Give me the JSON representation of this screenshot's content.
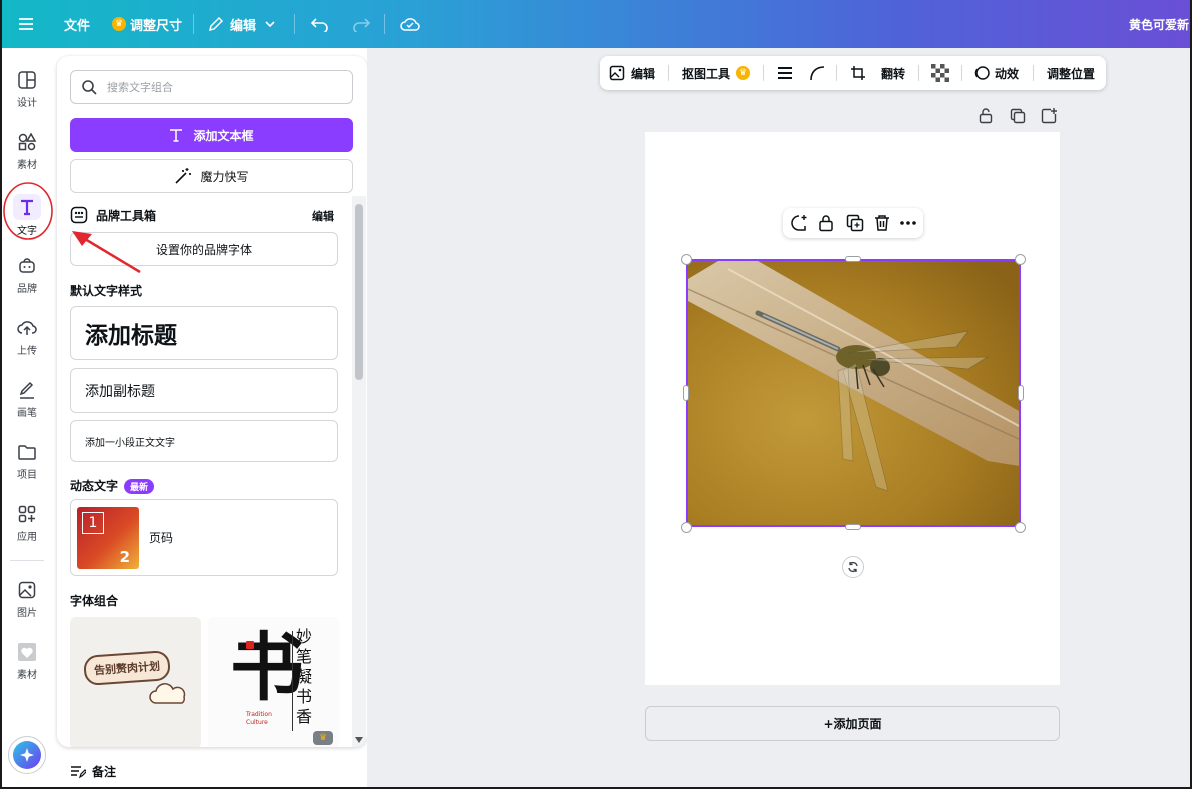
{
  "topbar": {
    "file": "文件",
    "resize": "调整尺寸",
    "edit": "编辑",
    "doc_title": "黄色可爱新"
  },
  "rail": {
    "items": [
      {
        "label": "设计",
        "icon": "layout-icon"
      },
      {
        "label": "素材",
        "icon": "shapes-icon"
      },
      {
        "label": "文字",
        "icon": "text-icon"
      },
      {
        "label": "品牌",
        "icon": "brand-icon"
      },
      {
        "label": "上传",
        "icon": "upload-cloud-icon"
      },
      {
        "label": "画笔",
        "icon": "pen-icon"
      },
      {
        "label": "项目",
        "icon": "folder-icon"
      },
      {
        "label": "应用",
        "icon": "apps-icon"
      },
      {
        "label": "图片",
        "icon": "image-icon"
      },
      {
        "label": "素材",
        "icon": "heart-icon"
      }
    ]
  },
  "panel": {
    "search_placeholder": "搜索文字组合",
    "add_textbox": "添加文本框",
    "magic_write": "魔力快写",
    "brand_kit": "品牌工具箱",
    "brand_edit": "编辑",
    "set_brand_fonts": "设置你的品牌字体",
    "default_styles": "默认文字样式",
    "add_heading": "添加标题",
    "add_subheading": "添加副标题",
    "add_body": "添加一小段正文文字",
    "dynamic_text": "动态文字",
    "new_badge": "最新",
    "page_number": "页码",
    "page_thumb_1": "1",
    "page_thumb_2": "2",
    "font_combos": "字体组合",
    "combo1_text": "告别赘肉计划",
    "combo2_big": "书",
    "combo2_vertical": "妙笔凝书香",
    "combo2_small1": "Tradition",
    "combo2_small2": "Culture"
  },
  "context_toolbar": {
    "edit": "编辑",
    "bg_remover": "抠图工具",
    "flip": "翻转",
    "animate": "动效",
    "position": "调整位置"
  },
  "canvas": {
    "add_page": "+添加页面"
  },
  "footer": {
    "notes": "备注"
  },
  "colors": {
    "accent": "#8b3dff",
    "annotation_red": "#e0282e"
  }
}
